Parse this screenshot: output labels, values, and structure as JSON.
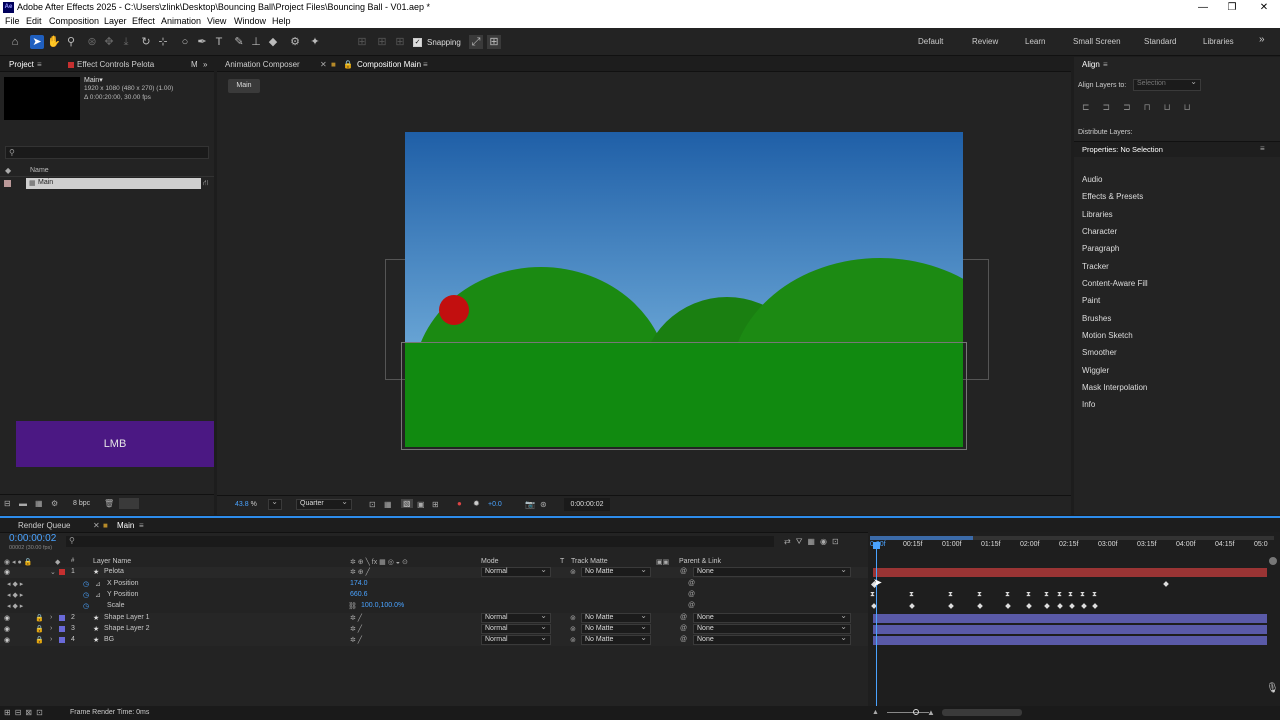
{
  "window": {
    "title": "Adobe After Effects 2025 - C:\\Users\\zlink\\Desktop\\Bouncing Ball\\Project Files\\Bouncing Ball - V01.aep *",
    "logo": "Ae",
    "minimize": "—",
    "maximize": "❐",
    "close": "✕"
  },
  "menu": [
    "File",
    "Edit",
    "Composition",
    "Layer",
    "Effect",
    "Animation",
    "View",
    "Window",
    "Help"
  ],
  "toolbar": {
    "snapping_label": "Snapping",
    "workspaces": [
      "Default",
      "Review",
      "Learn",
      "Small Screen",
      "Standard",
      "Libraries"
    ],
    "more": "»"
  },
  "project_panel": {
    "tab_project": "Project",
    "tab_effect_controls": "Effect Controls Pelota",
    "tab_more": "M",
    "comp_name": "Main",
    "comp_info_1": "1920 x 1080 (480 x 270) (1.00)",
    "comp_info_2": "Δ 0:00:20:00, 30.00 fps",
    "search_placeholder": "",
    "column_name": "Name",
    "items": [
      {
        "name": "Main"
      }
    ],
    "bpc": "8 bpc",
    "lmb_label": "LMB"
  },
  "viewer": {
    "tab_animation_composer": "Animation Composer",
    "tab_composition": "Composition Main",
    "crumb": "Main",
    "zoom": "43.8",
    "zoom_unit": "%",
    "resolution": "Quarter",
    "exposure": "+0.0",
    "timecode": "0:00:00:02"
  },
  "right_panel": {
    "align_title": "Align",
    "align_to_label": "Align Layers to:",
    "align_to_value": "Selection",
    "distribute_label": "Distribute Layers:",
    "properties_title": "Properties: No Selection",
    "items": [
      "Audio",
      "Effects & Presets",
      "Libraries",
      "Character",
      "Paragraph",
      "Tracker",
      "Content-Aware Fill",
      "Paint",
      "Brushes",
      "Motion Sketch",
      "Smoother",
      "Wiggler",
      "Mask Interpolation",
      "Info"
    ]
  },
  "timeline": {
    "tab_render_queue": "Render Queue",
    "tab_main": "Main",
    "current_time": "0:00:00:02",
    "fps_info": "00002 (30.00 fps)",
    "search_placeholder": "",
    "headers": {
      "num": "#",
      "layer_name": "Layer Name",
      "mode": "Mode",
      "t": "T",
      "track_matte": "Track Matte",
      "parent": "Parent & Link"
    },
    "ruler": [
      "0:00f",
      "00:15f",
      "01:00f",
      "01:15f",
      "02:00f",
      "02:15f",
      "03:00f",
      "03:15f",
      "04:00f",
      "04:15f",
      "05:0"
    ],
    "layers": [
      {
        "num": "1",
        "name": "Pelota",
        "mode": "Normal",
        "matte": "No Matte",
        "parent": "None",
        "color": "#c53030"
      },
      {
        "num": "2",
        "name": "Shape Layer 1",
        "mode": "Normal",
        "matte": "No Matte",
        "parent": "None",
        "color": "#6a6ad8"
      },
      {
        "num": "3",
        "name": "Shape Layer 2",
        "mode": "Normal",
        "matte": "No Matte",
        "parent": "None",
        "color": "#6a6ad8"
      },
      {
        "num": "4",
        "name": "BG",
        "mode": "Normal",
        "matte": "No Matte",
        "parent": "None",
        "color": "#6a6ad8"
      }
    ],
    "properties": [
      {
        "name": "X Position",
        "value": "174.0"
      },
      {
        "name": "Y Position",
        "value": "660.6"
      },
      {
        "name": "Scale",
        "value": "100.0,100.0%"
      }
    ],
    "status": "Frame Render Time:",
    "status_value": "0ms"
  },
  "colors": {
    "accent": "#2d8ceb",
    "selection": "#1f5fbf",
    "lmb_bg": "#4b1883",
    "ball": "#c20f0f",
    "hill": "#1b8a12",
    "layer_bar_red": "#9a3434",
    "layer_bar_blue": "#5a5aa8"
  }
}
